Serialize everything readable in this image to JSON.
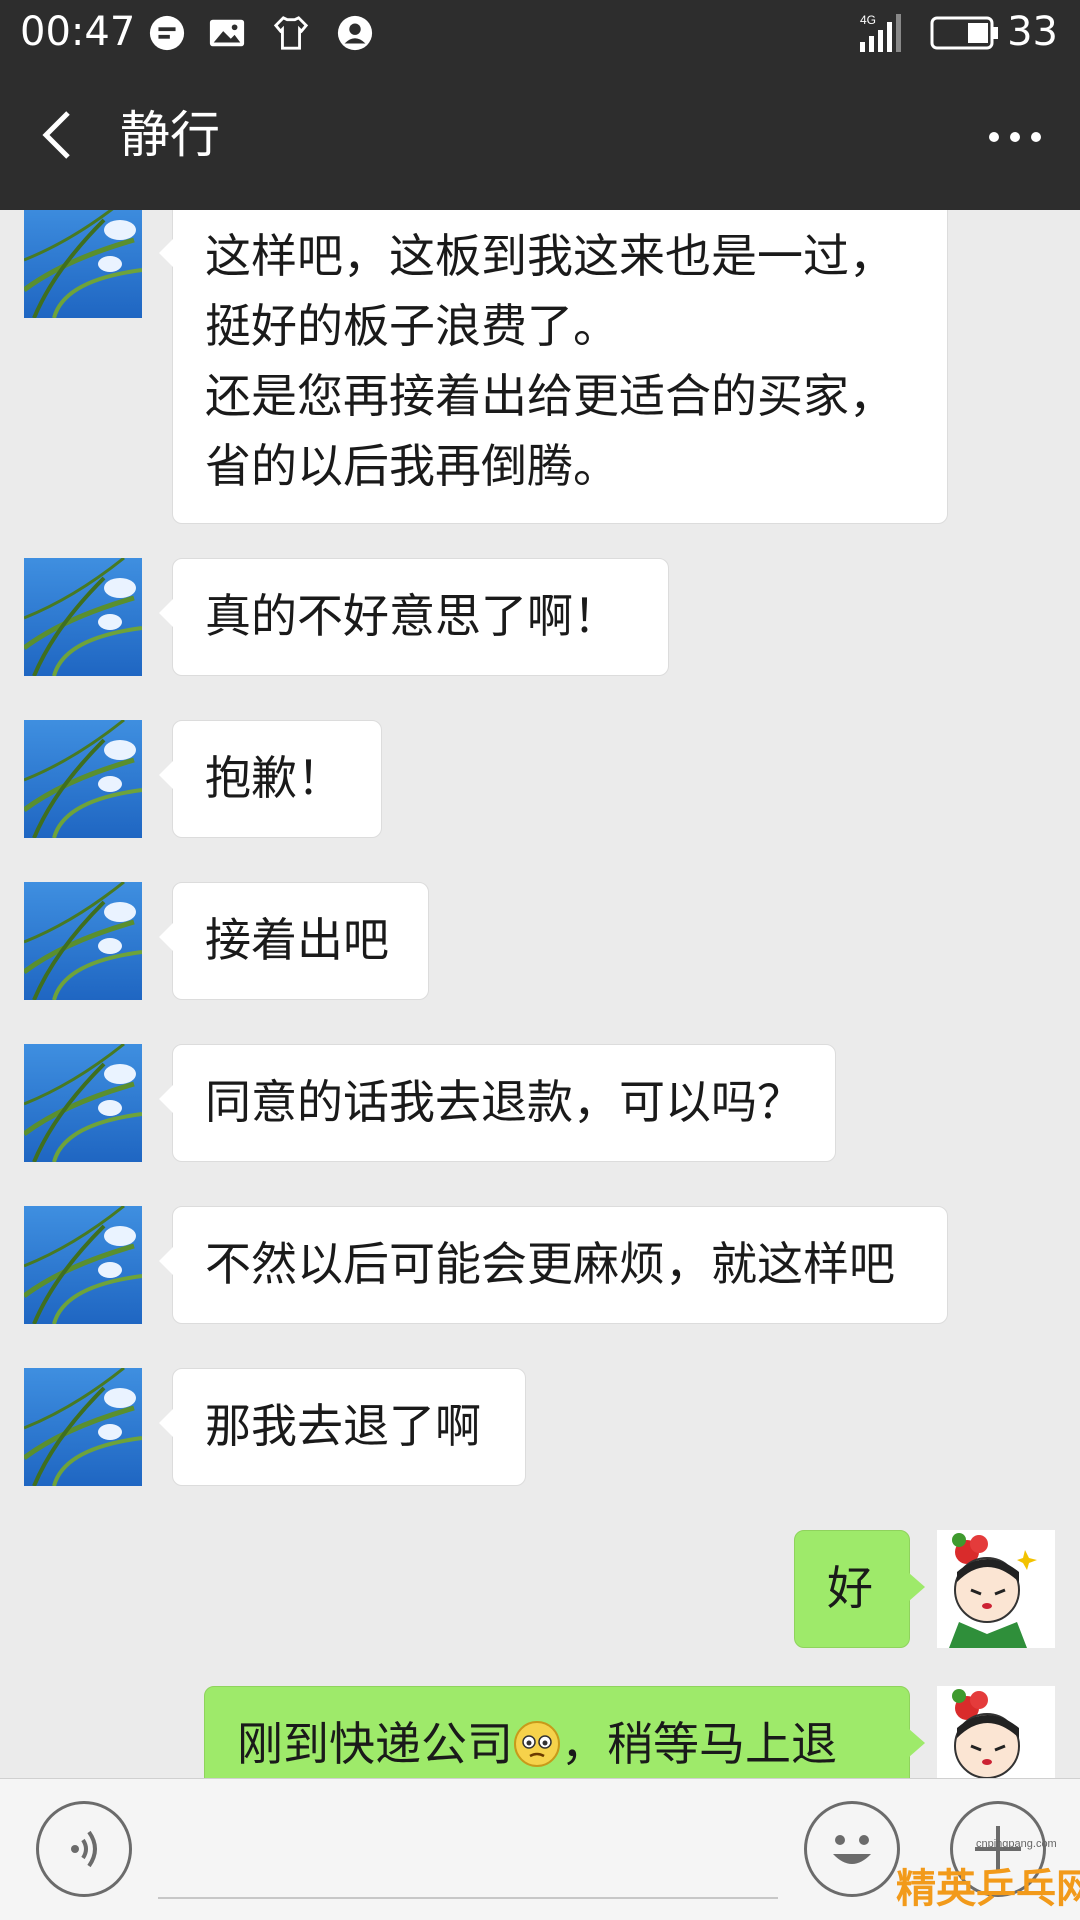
{
  "status_bar": {
    "time": "00:47",
    "network": "4G",
    "battery_level": "33",
    "icons": [
      "message-icon",
      "image-icon",
      "shirt-icon",
      "account-icon",
      "signal-icon",
      "battery-icon"
    ]
  },
  "header": {
    "title": "静行",
    "back_icon": "chevron-left-icon",
    "more_icon": "more-icon"
  },
  "messages": [
    {
      "side": "in",
      "lines": [
        "这样吧，这板到我这来也是一过，",
        "挺好的板子浪费了。",
        "还是您再接着出给更适合的买家，",
        "省的以后我再倒腾。"
      ]
    },
    {
      "side": "in",
      "lines": [
        "真的不好意思了啊！"
      ]
    },
    {
      "side": "in",
      "lines": [
        "抱歉！"
      ]
    },
    {
      "side": "in",
      "lines": [
        "接着出吧"
      ]
    },
    {
      "side": "in",
      "lines": [
        "同意的话我去退款，可以吗？"
      ]
    },
    {
      "side": "in",
      "lines": [
        "不然以后可能会更麻烦，就这样吧"
      ]
    },
    {
      "side": "in",
      "lines": [
        "那我去退了啊"
      ]
    },
    {
      "side": "out",
      "lines": [
        "好"
      ]
    },
    {
      "side": "out",
      "text_before_emoji": "刚到快递公司",
      "text_after_emoji": "，稍等马上退"
    }
  ],
  "input_bar": {
    "voice_icon": "voice-icon",
    "emoji_icon": "smiley-icon",
    "plus_icon": "plus-icon"
  },
  "watermark": {
    "domain": "cnpingpang.com",
    "brand": "精英乒乓网"
  },
  "colors": {
    "header_bg": "#2d2d2d",
    "chat_bg": "#ebebeb",
    "incoming_bubble": "#ffffff",
    "outgoing_bubble": "#9eea6a"
  }
}
